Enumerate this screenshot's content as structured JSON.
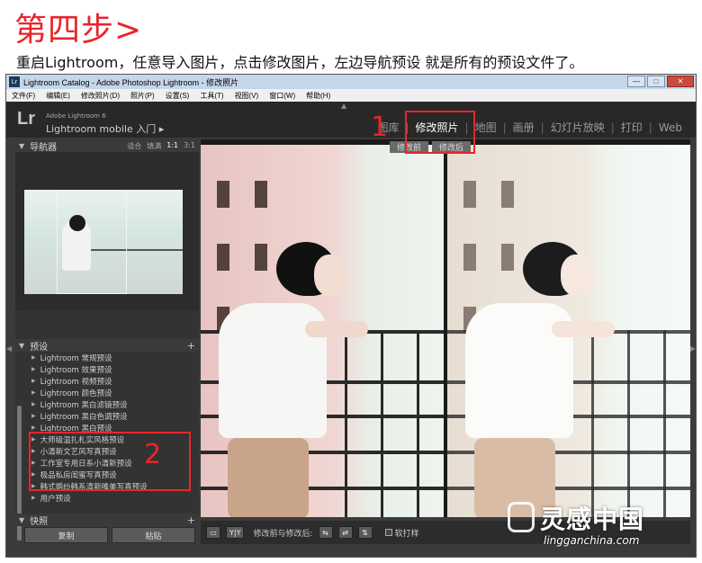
{
  "header": {
    "step_title": "第四步>",
    "instruction": "重启Lightroom，任意导入图片，点击修改图片，左边导航预设 就是所有的预设文件了。"
  },
  "window": {
    "title": "Lightroom Catalog - Adobe Photoshop Lightroom - 修改照片",
    "app_icon": "Lr",
    "controls": [
      "—",
      "□",
      "✕"
    ]
  },
  "menubar": [
    "文件(F)",
    "编辑(E)",
    "修改照片(D)",
    "照片(P)",
    "设置(S)",
    "工具(T)",
    "视图(V)",
    "窗口(W)",
    "帮助(H)"
  ],
  "identity": {
    "logo": "Lr",
    "version": "Adobe Lightroom 6",
    "mobile": "Lightroom mobile 入门 ▸"
  },
  "modules": [
    {
      "label": "图库",
      "active": false
    },
    {
      "label": "修改照片",
      "active": true
    },
    {
      "label": "地图",
      "active": false
    },
    {
      "label": "画册",
      "active": false
    },
    {
      "label": "幻灯片放映",
      "active": false
    },
    {
      "label": "打印",
      "active": false
    },
    {
      "label": "Web",
      "active": false
    }
  ],
  "navigator": {
    "title": "导航器",
    "options": [
      "适合",
      "填满",
      "1:1",
      "3:1"
    ],
    "selected_option": "1:1"
  },
  "presets": {
    "title": "预设",
    "add": "+",
    "items": [
      "Lightroom 常规预设",
      "Lightroom 效果预设",
      "Lightroom 视频预设",
      "Lightroom 颜色预设",
      "Lightroom 黑白滤镜预设",
      "Lightroom 黑白色调预设",
      "Lightroom 黑白预设",
      "大师级温扎札实风格预设",
      "小清新文艺风写真预设",
      "工作室专用日系小清新预设",
      "极品私房闺蜜写真预设",
      "韩式婚纱韩系清新唯美写真预设",
      "用户预设"
    ]
  },
  "snapshots": {
    "title": "快照",
    "add": "+"
  },
  "left_buttons": {
    "copy": "复制",
    "paste": "粘贴"
  },
  "viewer": {
    "before_label": "修改前",
    "after_label": "修改后"
  },
  "toolbar": {
    "view_btn": "▭",
    "yy_btn": "Y|Y",
    "label": "修改前与修改后:",
    "swap_left": "⇆",
    "swap_right": "⇄",
    "swap_up": "⇅",
    "soft_proof": "软打样"
  },
  "callouts": {
    "one": "1",
    "two": "2"
  },
  "watermark": {
    "cn": "灵感中国",
    "en": "lingganchina.com"
  },
  "colors": {
    "accent_red": "#e8262b",
    "panel_bg": "#333333",
    "app_bg": "#3b3b3b"
  }
}
